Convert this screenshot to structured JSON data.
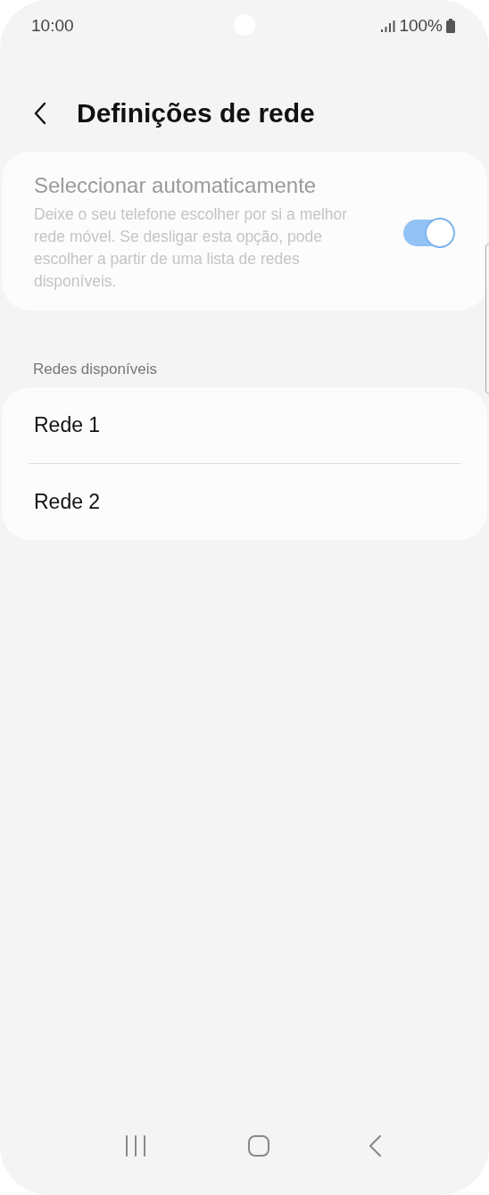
{
  "status_bar": {
    "time": "10:00",
    "battery": "100%"
  },
  "header": {
    "title": "Definições de rede"
  },
  "auto_select": {
    "title": "Seleccionar automaticamente",
    "description": "Deixe o seu telefone escolher por si a melhor rede móvel. Se desligar esta opção, pode escolher a partir de uma lista de redes disponíveis.",
    "on": true,
    "disabled": true
  },
  "section": {
    "title": "Redes disponíveis"
  },
  "networks": [
    {
      "label": "Rede 1"
    },
    {
      "label": "Rede 2"
    }
  ]
}
